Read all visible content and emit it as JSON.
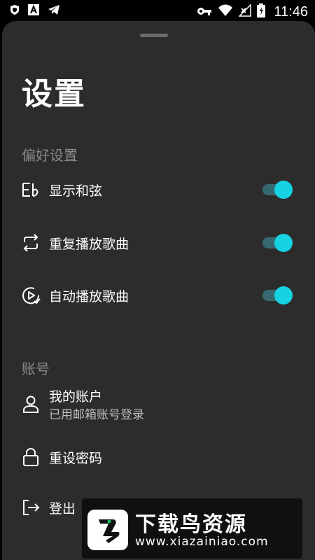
{
  "status_bar": {
    "time": "11:46",
    "icons": [
      "shield-icon",
      "a-icon",
      "telegram-icon",
      "key-icon",
      "wifi-icon",
      "signal-icon",
      "battery-icon"
    ]
  },
  "settings": {
    "title": "设置",
    "preferences": {
      "header": "偏好设置",
      "items": [
        {
          "label": "显示和弦",
          "icon": "chord-icon",
          "enabled": true
        },
        {
          "label": "重复播放歌曲",
          "icon": "repeat-icon",
          "enabled": true
        },
        {
          "label": "自动播放歌曲",
          "icon": "autoplay-icon",
          "enabled": true
        }
      ]
    },
    "account": {
      "header": "账号",
      "items": [
        {
          "label": "我的账户",
          "subtitle": "已用邮箱账号登录",
          "icon": "user-icon"
        },
        {
          "label": "重设密码",
          "icon": "lock-icon"
        },
        {
          "label": "登出",
          "icon": "logout-icon"
        }
      ]
    }
  },
  "watermark": {
    "title": "下载鸟资源",
    "url": "www.xiazainiao.com"
  },
  "colors": {
    "background": "#2c2c2c",
    "accent": "#16d2e2",
    "track": "#36696f",
    "muted": "#8b8b8b"
  }
}
